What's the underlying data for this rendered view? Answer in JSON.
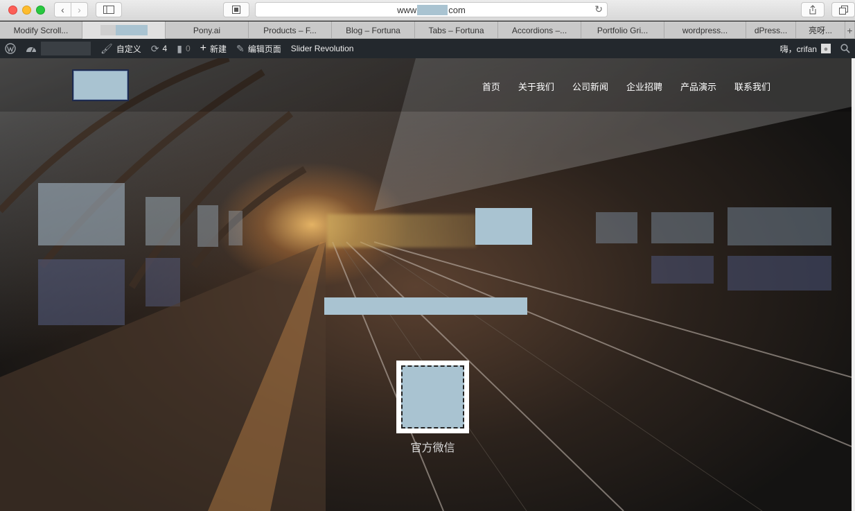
{
  "browser": {
    "url_prefix": "www",
    "url_suffix": "com",
    "tabs": [
      {
        "label": "Modify Scroll..."
      },
      {
        "label": ""
      },
      {
        "label": "Pony.ai"
      },
      {
        "label": "Products – F..."
      },
      {
        "label": "Blog – Fortuna"
      },
      {
        "label": "Tabs – Fortuna"
      },
      {
        "label": "Accordions –..."
      },
      {
        "label": "Portfolio Gri..."
      },
      {
        "label": "wordpress..."
      },
      {
        "label": "dPress..."
      },
      {
        "label": "亮呀..."
      }
    ],
    "add_tab_label": "+"
  },
  "adminbar": {
    "customize": "自定义",
    "updates_count": "4",
    "comments_count": "0",
    "new": "新建",
    "edit_page": "编辑页面",
    "slider": "Slider Revolution",
    "greeting": "嗨，crifan"
  },
  "site": {
    "nav": [
      "首页",
      "关于我们",
      "公司新闻",
      "企业招聘",
      "产品演示",
      "联系我们"
    ],
    "qr_caption": "官方微信"
  },
  "colors": {
    "redaction": "#a9c3d1",
    "adminbar_bg": "#23282d"
  }
}
